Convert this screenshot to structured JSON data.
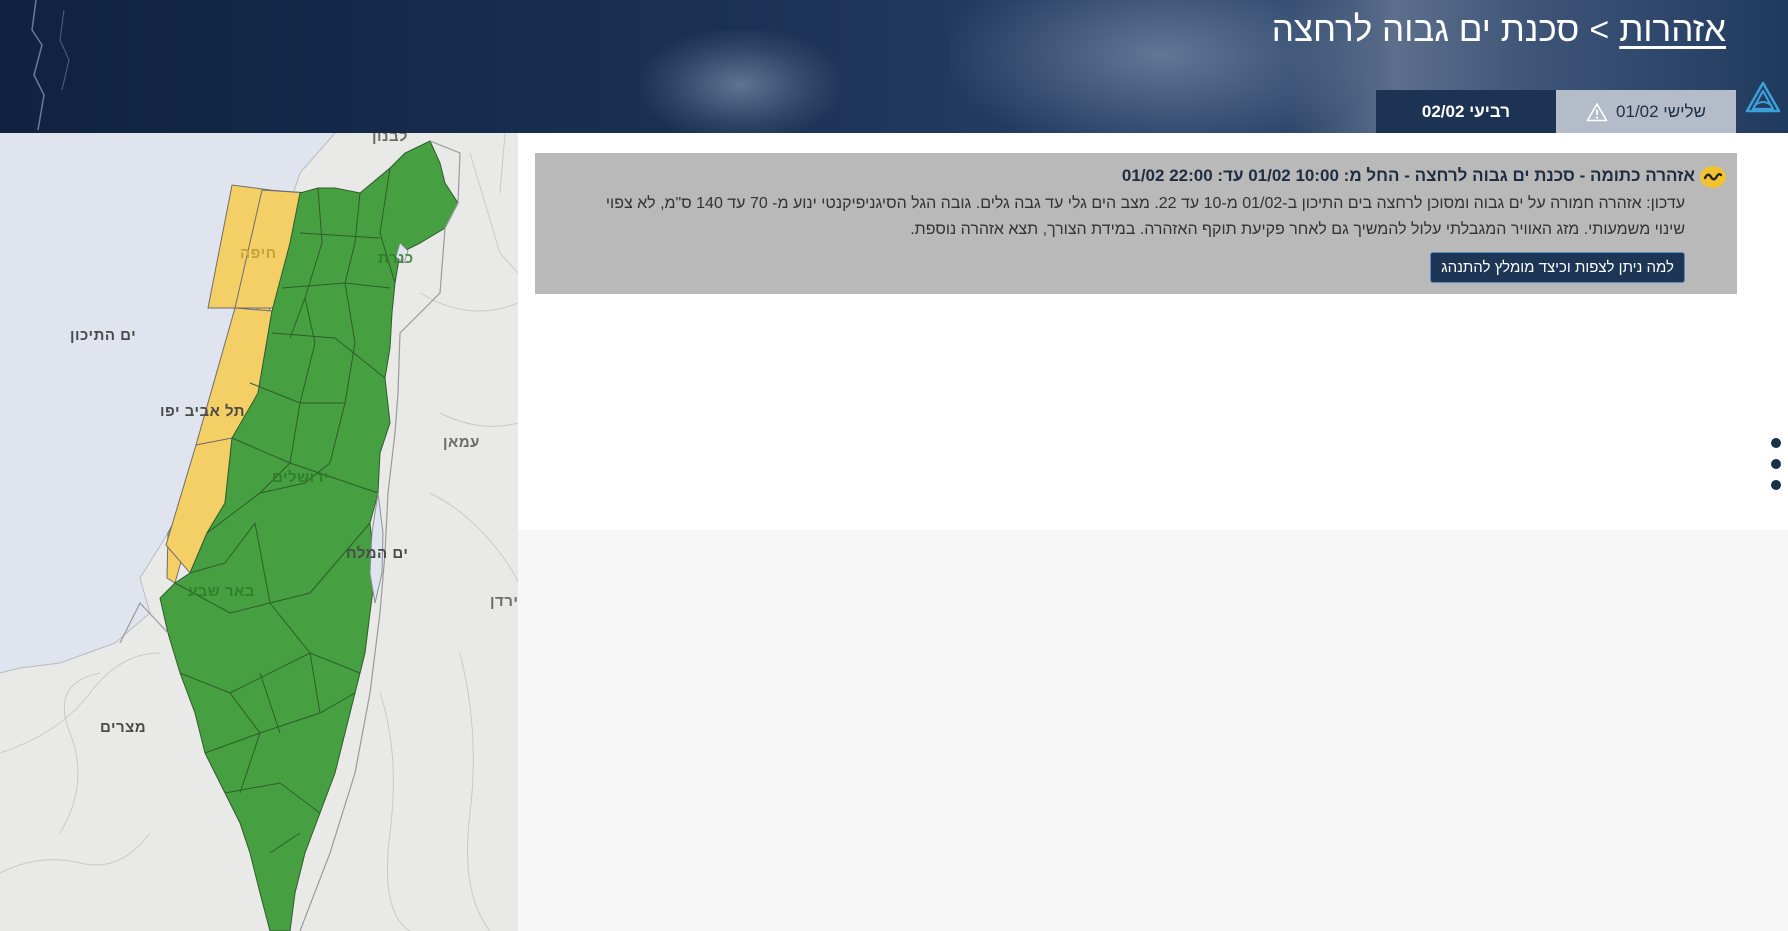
{
  "header": {
    "breadcrumb_link": "אזהרות",
    "breadcrumb_separator": ">",
    "title": "סכנת ים גבוה לרחצה"
  },
  "tabs": [
    {
      "label": "שלישי 01/02",
      "active": true,
      "icon": "warning-triangle-icon"
    },
    {
      "label": "רביעי 02/02",
      "active": false
    }
  ],
  "map": {
    "labels": {
      "lebanon": "לבנון",
      "haifa": "חיפה",
      "kinneret": "כנרת",
      "med_sea": "ים התיכון",
      "tel_aviv": "תל אביב יפו",
      "amman": "עמאן",
      "jerusalem": "ירושלים",
      "dead_sea": "ים המלח",
      "jordan": "ירדן",
      "beer_sheva": "באר שבע",
      "egypt": "מצרים"
    },
    "colors": {
      "land_warning": "#46a041",
      "coast_warning": "#f3cf65",
      "sea": "#dfe4ee",
      "land": "#e9e9e7"
    }
  },
  "alert": {
    "icon": "wave-warning-icon",
    "title": "אזהרה כתומה - סכנת ים גבוה לרחצה - החל מ: 10:00 01/02 עד: 22:00 01/02",
    "body": "עדכון: אזהרה חמורה על ים גבוה ומסוכן לרחצה בים התיכון ב-01/02 מ-10 עד 22. מצב הים גלי עד גבה גלים. גובה הגל הסיגניפיקנטי ינוע מ- 70 עד 140 ס\"מ, לא צפוי שינוי משמעותי. מזג האוויר המגבלתי עלול להמשיך גם לאחר פקיעת תוקף האזהרה. במידת הצורך, תצא אזהרה נוספת.",
    "button_label": "למה ניתן לצפות וכיצד מומלץ להתנהג"
  },
  "colors": {
    "header_dark": "#1d3353",
    "tab_active": "#b3bcc8",
    "alert_bg": "#b9b9b9",
    "button_bg": "#1d3656",
    "logo": "#3aa0d8"
  }
}
